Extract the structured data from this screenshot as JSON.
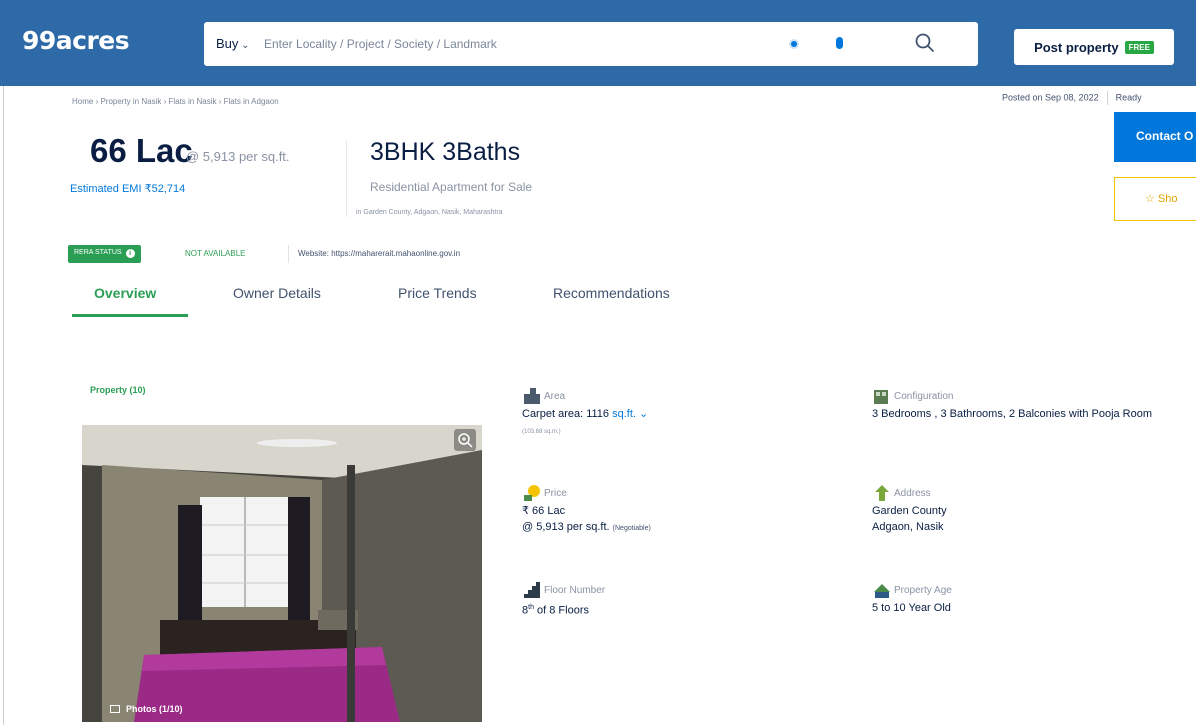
{
  "header": {
    "logo": "99acres",
    "buy_label": "Buy",
    "search_placeholder": "Enter Locality / Project / Society / Landmark",
    "post_property_label": "Post property",
    "free_badge": "FREE"
  },
  "breadcrumb": "Home › Property in Nasik › Flats in Nasik › Flats in Adgaon",
  "posted": {
    "text": "Posted on Sep 08, 2022",
    "status": "Ready"
  },
  "summary": {
    "price": "66 Lac",
    "per_sqft": "@ 5,913 per sq.ft.",
    "emi": "Estimated EMI ₹52,714",
    "title": "3BHK 3Baths",
    "subtitle": "Residential Apartment for Sale",
    "address": "in Garden County, Adgaon, Nasik, Maharashtra"
  },
  "actions": {
    "contact": "Contact O",
    "shortlist": "Sho"
  },
  "rera": {
    "badge": "RERA STATUS",
    "info_icon": "i",
    "status": "NOT AVAILABLE",
    "website": "Website: https://maharerait.mahaonline.gov.in"
  },
  "tabs": [
    "Overview",
    "Owner Details",
    "Price Trends",
    "Recommendations"
  ],
  "property_label": "Property (10)",
  "photos_caption": "Photos (1/10)",
  "details": {
    "area": {
      "label": "Area",
      "value": "Carpet area: 1116",
      "unit": "sq.ft.",
      "sub": "(103.68 sq.m.)"
    },
    "configuration": {
      "label": "Configuration",
      "value": "3 Bedrooms , 3 Bathrooms, 2 Balconies with Pooja Room"
    },
    "price": {
      "label": "Price",
      "value": "₹ 66 Lac",
      "per": "@ 5,913 per sq.ft.",
      "negotiable": "(Negotiable)"
    },
    "address": {
      "label": "Address",
      "line1": "Garden County",
      "line2": "Adgaon, Nasik"
    },
    "floor": {
      "label": "Floor Number",
      "floor": "8",
      "sup": "th",
      "of": "of 8 Floors"
    },
    "age": {
      "label": "Property Age",
      "value": "5 to 10 Year Old"
    }
  },
  "colors": {
    "brand_blue": "#2f6aa8",
    "accent_green": "#2b9e55",
    "link_blue": "#0078db"
  }
}
